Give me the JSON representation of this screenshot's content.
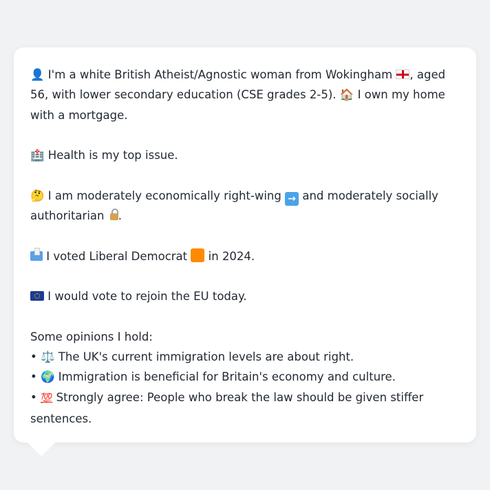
{
  "profile": {
    "intro_a": "I'm a white British Atheist/Agnostic woman from Wokingham",
    "intro_b": ", aged 56, with lower secondary education (CSE grades 2-5).",
    "intro_c": " I own my home with a mortgage.",
    "health": " Health is my top issue.",
    "economic_a": " I am moderately economically right-wing",
    "economic_b": " and moderately socially authoritarian",
    "economic_c": ".",
    "vote_a": " I voted Liberal Democrat",
    "vote_b": " in 2024.",
    "eu": " I would vote to rejoin the EU today."
  },
  "opinions": {
    "heading": "Some opinions I hold:",
    "items": [
      {
        "bullet": "•",
        "text": " The UK's current immigration levels are about right."
      },
      {
        "bullet": "•",
        "text": " Immigration is beneficial for Britain's economy and culture."
      },
      {
        "bullet": "•",
        "text": " Strongly agree: People who break the law should be given stiffer sentences."
      }
    ]
  },
  "icons": {
    "person": "👤",
    "house": "🏠",
    "hospital": "🏥",
    "thinking": "🤔",
    "scales": "⚖️",
    "globe": "🌍",
    "hundred": "💯"
  },
  "colors": {
    "background": "#f1f2f4",
    "bubble": "#ffffff",
    "text": "#232a33",
    "lib_dem": "#ff8a00"
  }
}
